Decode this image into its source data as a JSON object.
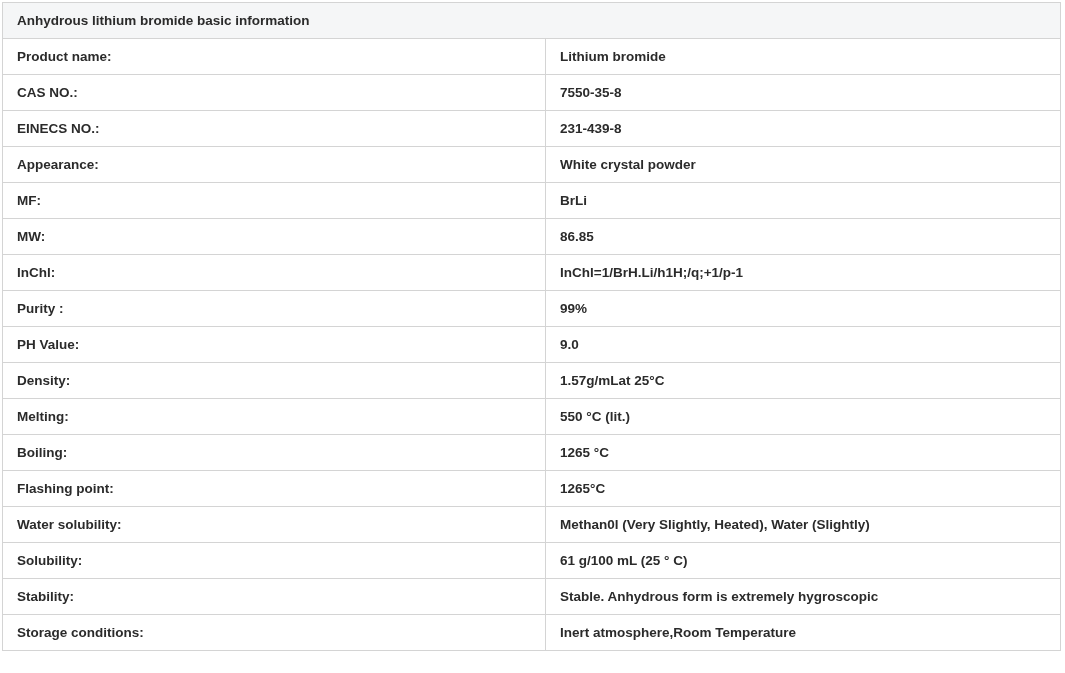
{
  "table": {
    "title": "Anhydrous lithium bromide basic information",
    "rows": [
      {
        "label": "Product name:",
        "value": "Lithium bromide"
      },
      {
        "label": "CAS NO.:",
        "value": "7550-35-8"
      },
      {
        "label": "EINECS NO.:",
        "value": "231-439-8"
      },
      {
        "label": "Appearance:",
        "value": "White crystal powder"
      },
      {
        "label": "MF:",
        "value": "BrLi"
      },
      {
        "label": "MW:",
        "value": "86.85"
      },
      {
        "label": "InChl:",
        "value": "InChl=1/BrH.Li/h1H;/q;+1/p-1"
      },
      {
        "label": "Purity :",
        "value": "99%"
      },
      {
        "label": "PH Value:",
        "value": "9.0"
      },
      {
        "label": "Density:",
        "value": "1.57g/mLat 25°C"
      },
      {
        "label": "Melting:",
        "value": "550 °C (lit.)"
      },
      {
        "label": "Boiling:",
        "value": "1265 °C"
      },
      {
        "label": "Flashing point:",
        "value": "1265°C"
      },
      {
        "label": "Water solubility:",
        "value": "Methan0l (Very Slightly, Heated), Water (Slightly)"
      },
      {
        "label": "Solubility:",
        "value": "61 g/100 mL (25 ° C)"
      },
      {
        "label": "Stability:",
        "value": "Stable. Anhydrous form is extremely hygroscopic"
      },
      {
        "label": "Storage conditions:",
        "value": "Inert atmosphere,Room Temperature"
      }
    ]
  }
}
